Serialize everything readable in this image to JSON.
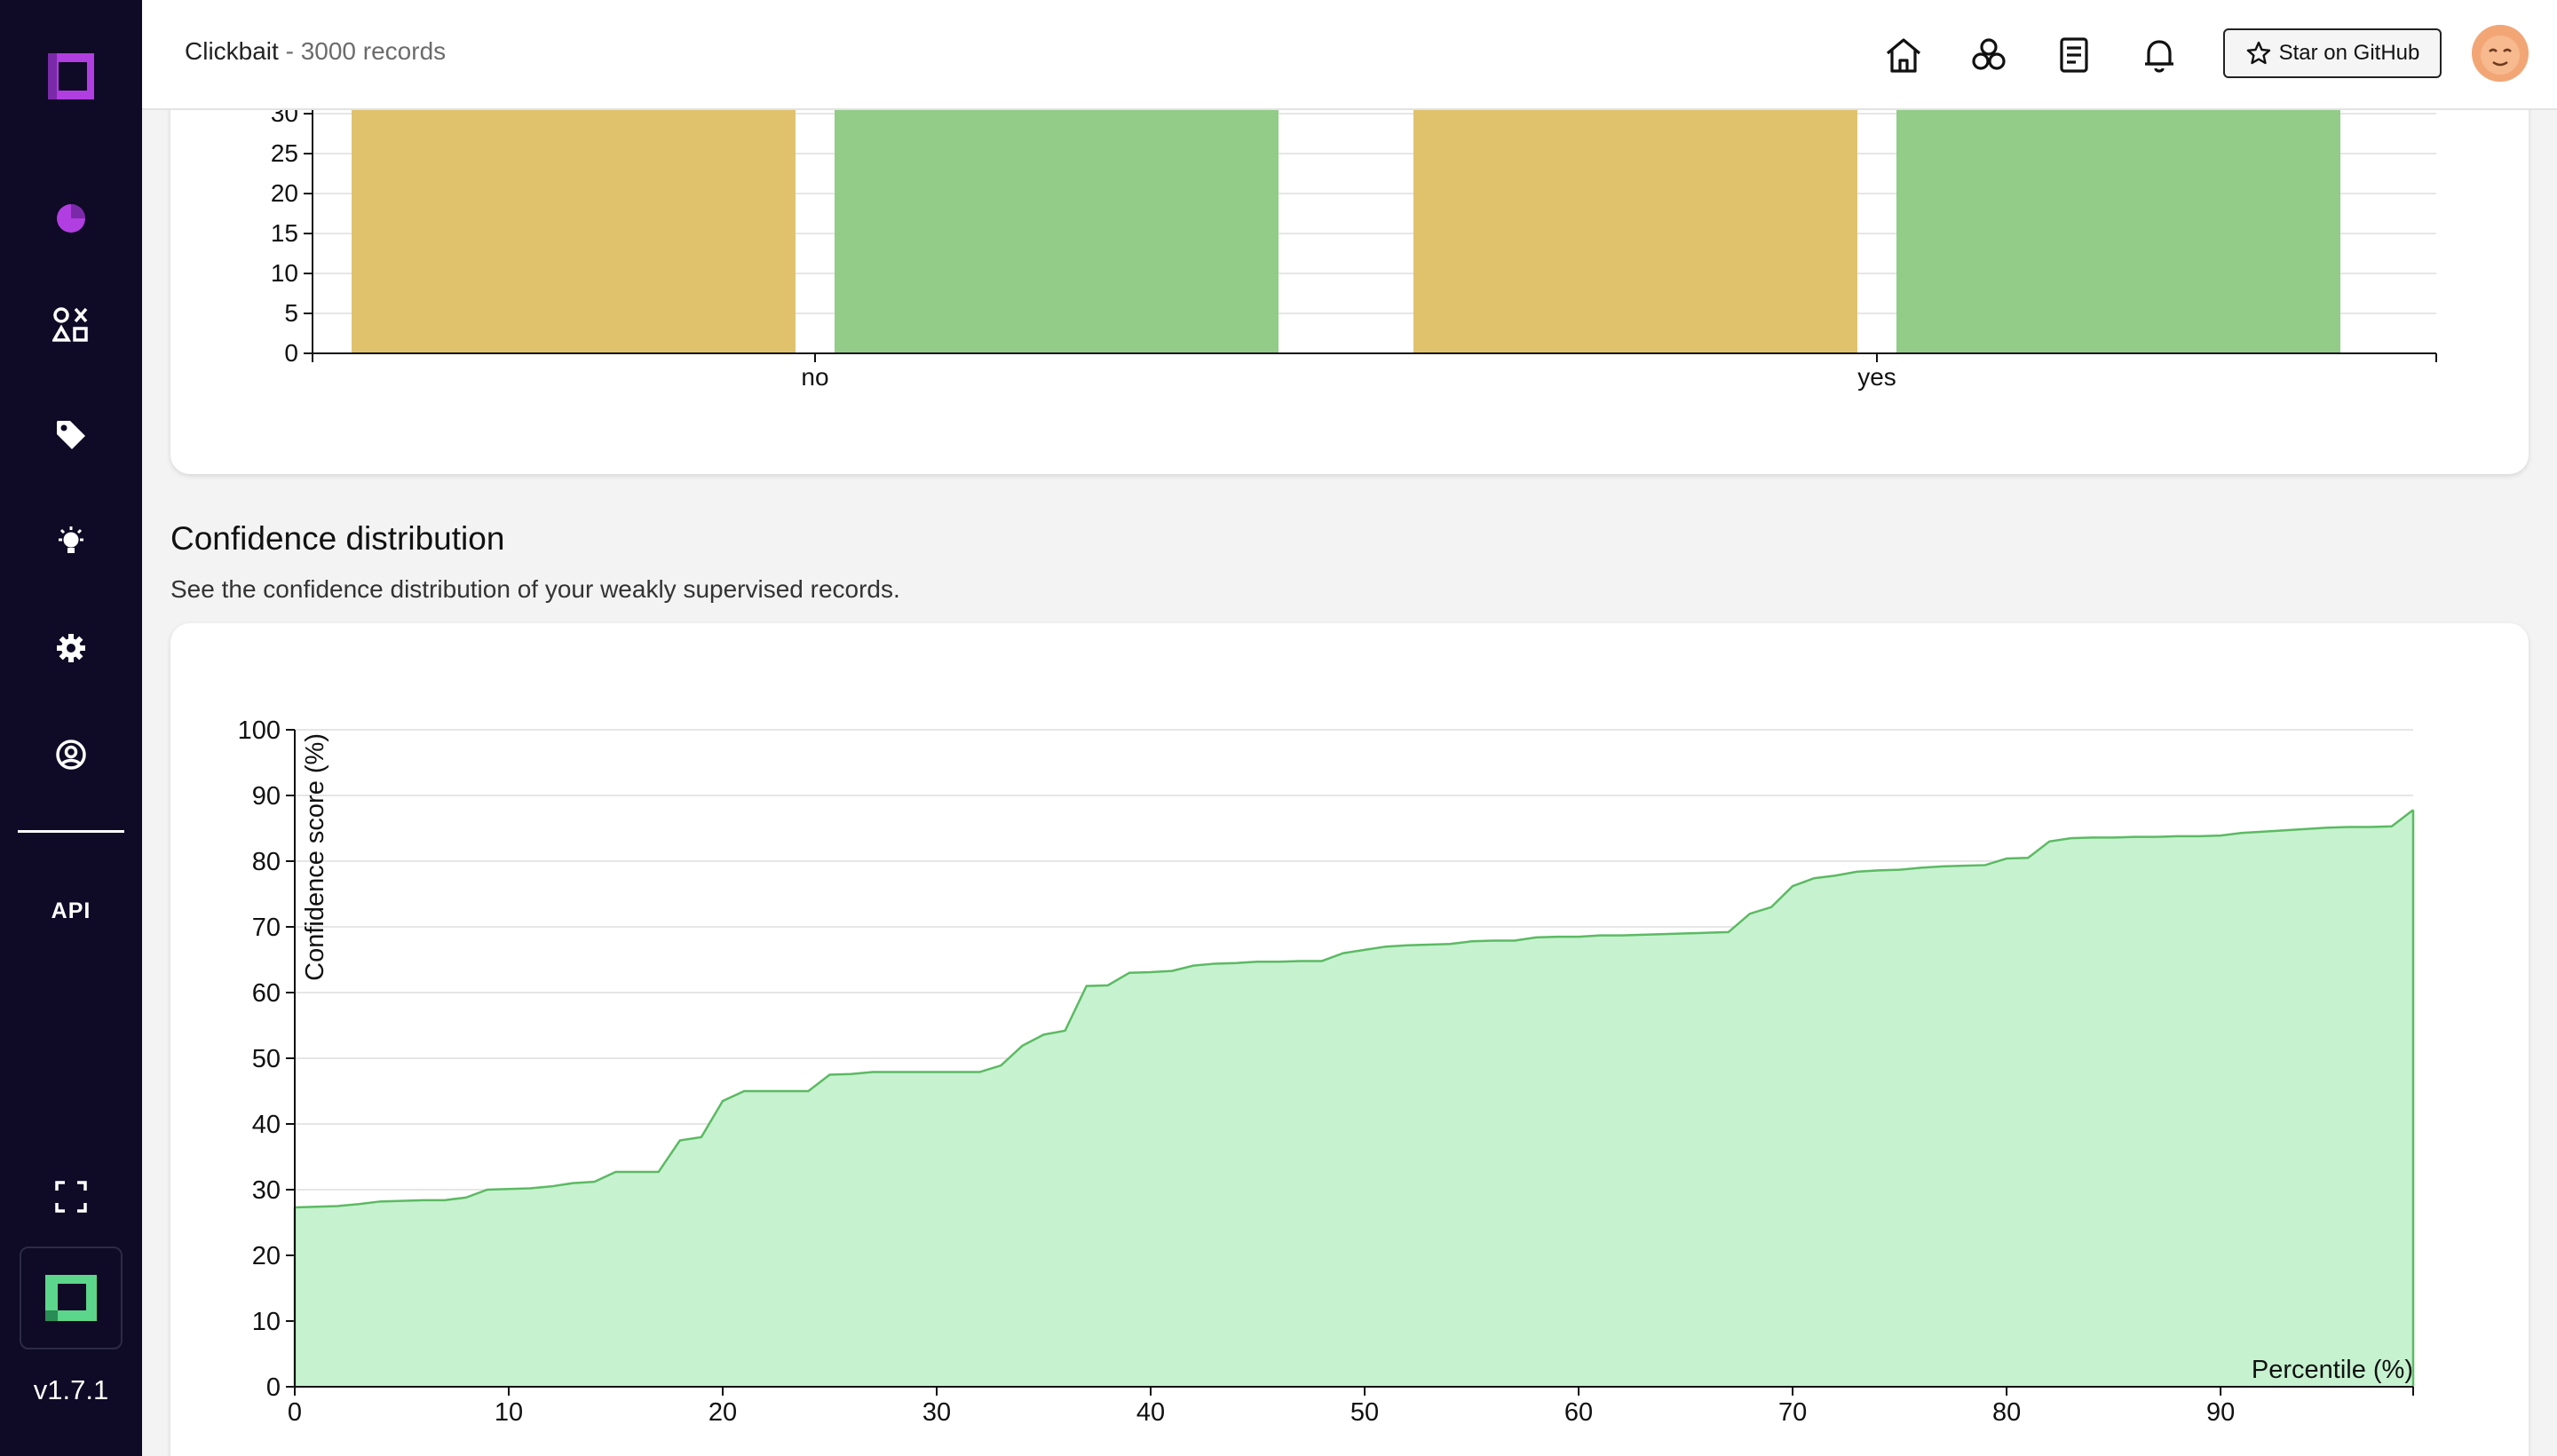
{
  "header": {
    "project_name": "Clickbait",
    "separator": " - ",
    "record_count": "3000 records",
    "github_label": "Star on GitHub"
  },
  "sidebar": {
    "items": [
      {
        "icon": "pie-chart-icon"
      },
      {
        "icon": "shapes-icon"
      },
      {
        "icon": "tag-icon"
      },
      {
        "icon": "lightbulb-icon"
      },
      {
        "icon": "gear-icon"
      },
      {
        "icon": "user-circle-icon"
      }
    ],
    "api_label": "API",
    "version": "v1.7.1"
  },
  "top_chart_ticks": {
    "y": [
      "30",
      "25",
      "20",
      "15",
      "10",
      "5",
      "0"
    ],
    "x": [
      "no",
      "yes"
    ]
  },
  "confidence_section": {
    "title": "Confidence distribution",
    "description": "See the confidence distribution of your weakly supervised records."
  },
  "colors": {
    "sidebar_bg": "#0f0a26",
    "accent_purple": "#b13ee0",
    "bar_yellow": "#e0c26d",
    "bar_green": "#92cc88",
    "area_fill": "#c6f2d0",
    "area_line": "#5cba63"
  },
  "chart_data": [
    {
      "type": "bar",
      "categories": [
        "no",
        "yes"
      ],
      "series": [
        {
          "values": [
            30,
            30
          ]
        },
        {
          "values": [
            30,
            30
          ]
        }
      ],
      "title": "",
      "xlabel": "",
      "ylabel": "",
      "ylim": [
        0,
        30
      ],
      "grid": true
    },
    {
      "type": "area",
      "title": "",
      "xlabel": "Percentile (%)",
      "ylabel": "Confidence score (%)",
      "xlim": [
        0,
        99
      ],
      "ylim": [
        0,
        100
      ],
      "x_ticks": [
        "0",
        "10",
        "20",
        "30",
        "40",
        "50",
        "60",
        "70",
        "80",
        "90"
      ],
      "y_ticks": [
        "0",
        "10",
        "20",
        "30",
        "40",
        "50",
        "60",
        "70",
        "80",
        "90",
        "100"
      ],
      "grid": true,
      "x": [
        0,
        1,
        2,
        3,
        4,
        5,
        6,
        7,
        8,
        9,
        10,
        11,
        12,
        13,
        14,
        15,
        16,
        17,
        18,
        19,
        20,
        21,
        22,
        23,
        24,
        25,
        26,
        27,
        28,
        29,
        30,
        31,
        32,
        33,
        34,
        35,
        36,
        37,
        38,
        39,
        40,
        41,
        42,
        43,
        44,
        45,
        46,
        47,
        48,
        49,
        50,
        51,
        52,
        53,
        54,
        55,
        56,
        57,
        58,
        59,
        60,
        61,
        62,
        63,
        64,
        65,
        66,
        67,
        68,
        69,
        70,
        71,
        72,
        73,
        74,
        75,
        76,
        77,
        78,
        79,
        80,
        81,
        82,
        83,
        84,
        85,
        86,
        87,
        88,
        89,
        90,
        91,
        92,
        93,
        94,
        95,
        96,
        97,
        98,
        99
      ],
      "values": [
        27.3,
        27.4,
        27.5,
        27.8,
        28.2,
        28.3,
        28.4,
        28.4,
        28.8,
        30.0,
        30.1,
        30.2,
        30.5,
        31.0,
        31.2,
        32.7,
        32.7,
        32.7,
        37.5,
        38.0,
        43.5,
        45.0,
        45.0,
        45.0,
        45.0,
        47.5,
        47.6,
        47.9,
        47.9,
        47.9,
        47.9,
        47.9,
        47.9,
        48.9,
        51.9,
        53.6,
        54.2,
        61.0,
        61.1,
        63.0,
        63.1,
        63.3,
        64.1,
        64.4,
        64.5,
        64.7,
        64.7,
        64.8,
        64.8,
        66.0,
        66.5,
        67.0,
        67.2,
        67.3,
        67.4,
        67.8,
        67.9,
        67.9,
        68.4,
        68.5,
        68.5,
        68.7,
        68.7,
        68.8,
        68.9,
        69.0,
        69.1,
        69.2,
        72.0,
        73.0,
        76.2,
        77.4,
        77.8,
        78.4,
        78.6,
        78.7,
        79.0,
        79.2,
        79.3,
        79.4,
        80.4,
        80.5,
        83.0,
        83.5,
        83.6,
        83.6,
        83.7,
        83.7,
        83.8,
        83.8,
        83.9,
        84.3,
        84.5,
        84.7,
        84.9,
        85.1,
        85.2,
        85.2,
        85.3,
        87.8
      ]
    }
  ]
}
